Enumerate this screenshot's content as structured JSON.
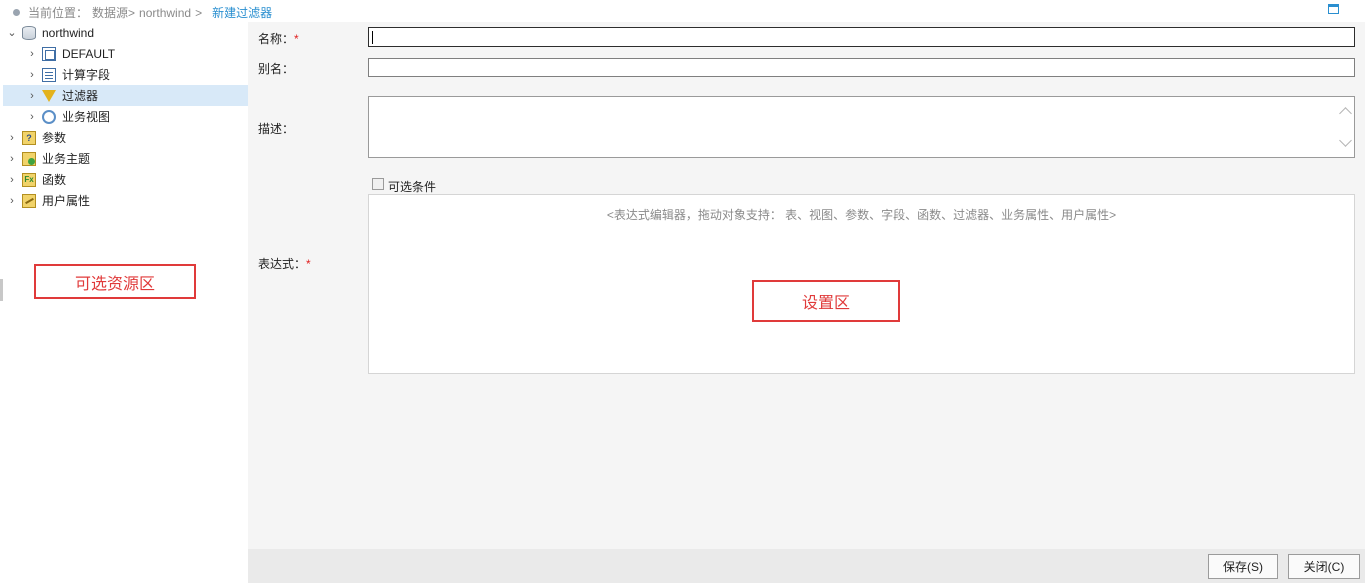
{
  "breadcrumb": {
    "prefix": "当前位置：",
    "items": [
      "数据源>",
      "northwind",
      ">"
    ],
    "current": "新建过滤器"
  },
  "tree": {
    "root": {
      "label": "northwind",
      "icon": "database-icon"
    },
    "children": [
      {
        "label": "DEFAULT",
        "icon": "table-icon"
      },
      {
        "label": "计算字段",
        "icon": "calc-field-icon"
      },
      {
        "label": "过滤器",
        "icon": "filter-icon",
        "selected": true
      },
      {
        "label": "业务视图",
        "icon": "view-icon"
      }
    ],
    "others": [
      {
        "label": "参数",
        "icon": "param-icon"
      },
      {
        "label": "业务主题",
        "icon": "topic-icon"
      },
      {
        "label": "函数",
        "icon": "function-icon"
      },
      {
        "label": "用户属性",
        "icon": "user-attr-icon"
      }
    ]
  },
  "annotations": {
    "left": "可选资源区",
    "right": "设置区",
    "color": "#e03a3a"
  },
  "form": {
    "name_label": "名称：",
    "alias_label": "别名：",
    "desc_label": "描述：",
    "optional_label": "可选条件",
    "expr_label": "表达式：",
    "required_mark": "*",
    "expr_hint": "<表达式编辑器，拖动对象支持：  表、视图、参数、字段、函数、过滤器、业务属性、用户属性>",
    "name_value": "",
    "alias_value": "",
    "desc_value": ""
  },
  "buttons": {
    "save": "保存(S)",
    "close": "关闭(C)"
  },
  "colors": {
    "accent": "#2a8fd0",
    "selected_bg": "#d8e9f8",
    "required": "#e02020"
  }
}
